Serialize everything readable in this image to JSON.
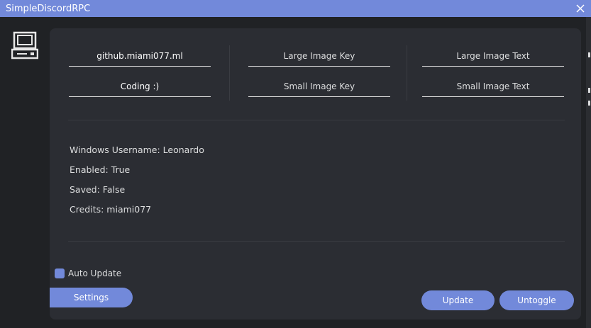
{
  "window": {
    "title": "SimpleDiscordRPC"
  },
  "fields": {
    "details": "github.miami077.ml",
    "state": "Coding :)",
    "large_image_key": "Large Image Key",
    "small_image_key": "Small Image Key",
    "large_image_text": "Large Image Text",
    "small_image_text": "Small Image Text"
  },
  "info": {
    "username": "Windows Username: Leonardo",
    "enabled": "Enabled: True",
    "saved": "Saved: False",
    "credits": "Credits: miami077"
  },
  "auto_update": {
    "label": "Auto Update",
    "checked": true
  },
  "buttons": {
    "settings": "Settings",
    "update": "Update",
    "untoggle": "Untoggle"
  },
  "colors": {
    "accent": "#7289da",
    "background": "#202225",
    "panel": "#2b2d33"
  },
  "icons": {
    "app": "computer-icon",
    "close": "close-icon"
  }
}
